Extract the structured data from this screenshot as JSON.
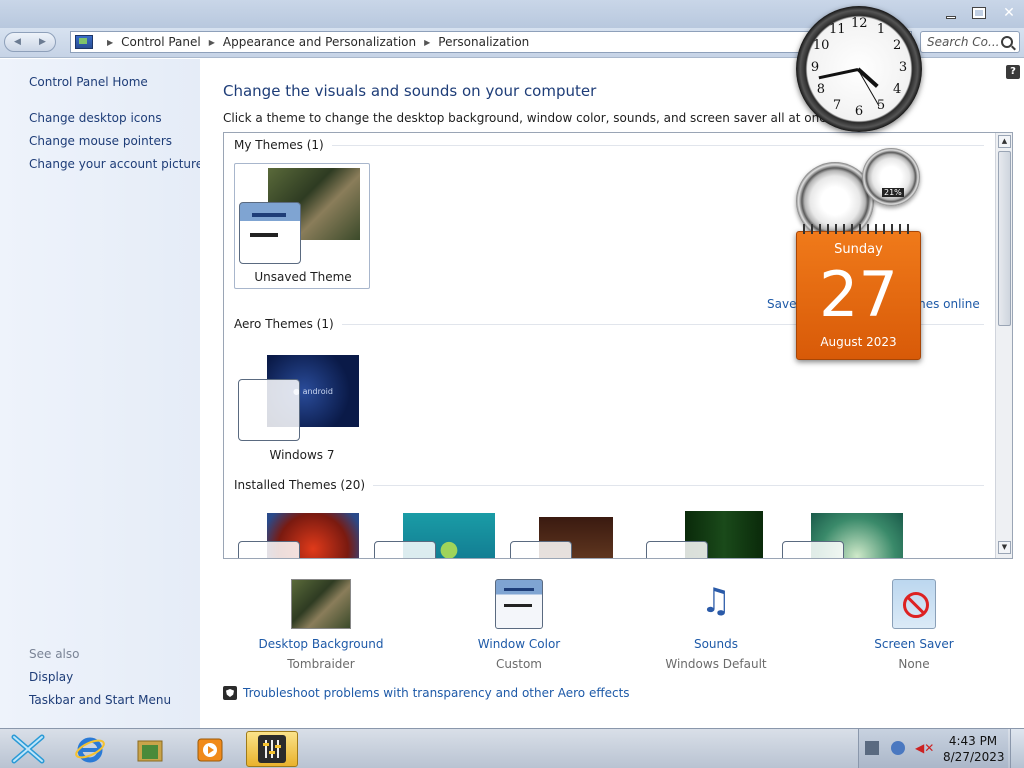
{
  "window": {
    "controls": {
      "minimize": "minimize",
      "maximize": "maximize",
      "close": "close"
    }
  },
  "address": {
    "crumbs": [
      "Control Panel",
      "Appearance and Personalization",
      "Personalization"
    ],
    "search_placeholder": "Search Co..."
  },
  "left_pane": {
    "home": "Control Panel Home",
    "links": [
      "Change desktop icons",
      "Change mouse pointers",
      "Change your account picture"
    ],
    "see_also_label": "See also",
    "see_also": [
      "Display",
      "Taskbar and Start Menu"
    ]
  },
  "main": {
    "help": "?",
    "title": "Change the visuals and sounds on your computer",
    "subtitle": "Click a theme to change the desktop background, window color, sounds, and screen saver all at once.",
    "sections": {
      "my_themes": "My Themes (1)",
      "aero_themes": "Aero Themes (1)",
      "installed_themes": "Installed Themes (20)"
    },
    "themes": {
      "unsaved": "Unsaved Theme",
      "windows7": "Windows 7"
    },
    "save_link_left": "Save t",
    "save_link_right": "mes online",
    "settings": [
      {
        "link": "Desktop Background",
        "value": "Tombraider"
      },
      {
        "link": "Window Color",
        "value": "Custom"
      },
      {
        "link": "Sounds",
        "value": "Windows Default"
      },
      {
        "link": "Screen Saver",
        "value": "None"
      }
    ],
    "troubleshoot": "Troubleshoot problems with transparency and other Aero effects"
  },
  "gadgets": {
    "clock_numbers": [
      "12",
      "1",
      "2",
      "3",
      "4",
      "5",
      "6",
      "7",
      "8",
      "9",
      "10",
      "11"
    ],
    "meter_value": "21%",
    "calendar": {
      "day": "Sunday",
      "date": "27",
      "month": "August 2023"
    }
  },
  "taskbar": {
    "time": "4:43 PM",
    "date": "8/27/2023"
  }
}
